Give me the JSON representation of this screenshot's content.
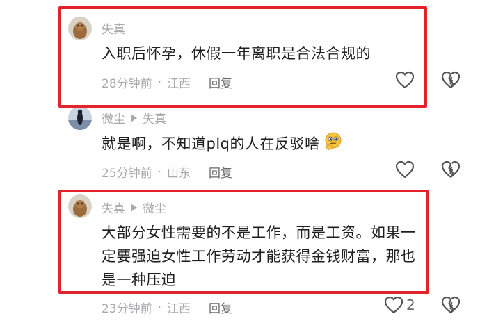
{
  "comments": [
    {
      "username": "失真",
      "reply_to": "",
      "text": "入职后怀孕，休假一年离职是合法合规的",
      "time": "28分钟前",
      "location": "江西",
      "reply_label": "回复",
      "likes": ""
    },
    {
      "username": "微尘",
      "reply_to": "失真",
      "text": "就是啊，不知道plq的人在反驳啥",
      "emoji": "thinking-face-emoji",
      "time": "25分钟前",
      "location": "山东",
      "reply_label": "回复",
      "likes": ""
    },
    {
      "username": "失真",
      "reply_to": "微尘",
      "text_lines": [
        "大部分女性需要的不是工作，而是工资。如果一",
        "定要强迫女性工作劳动才能获得金钱财富，那也",
        "是一种压迫"
      ],
      "time": "23分钟前",
      "location": "江西",
      "reply_label": "回复",
      "likes": "2"
    }
  ],
  "separator": "·",
  "colors": {
    "highlight": "#e3232a",
    "meta": "#a9a9ad",
    "text": "#1f1f1f"
  }
}
